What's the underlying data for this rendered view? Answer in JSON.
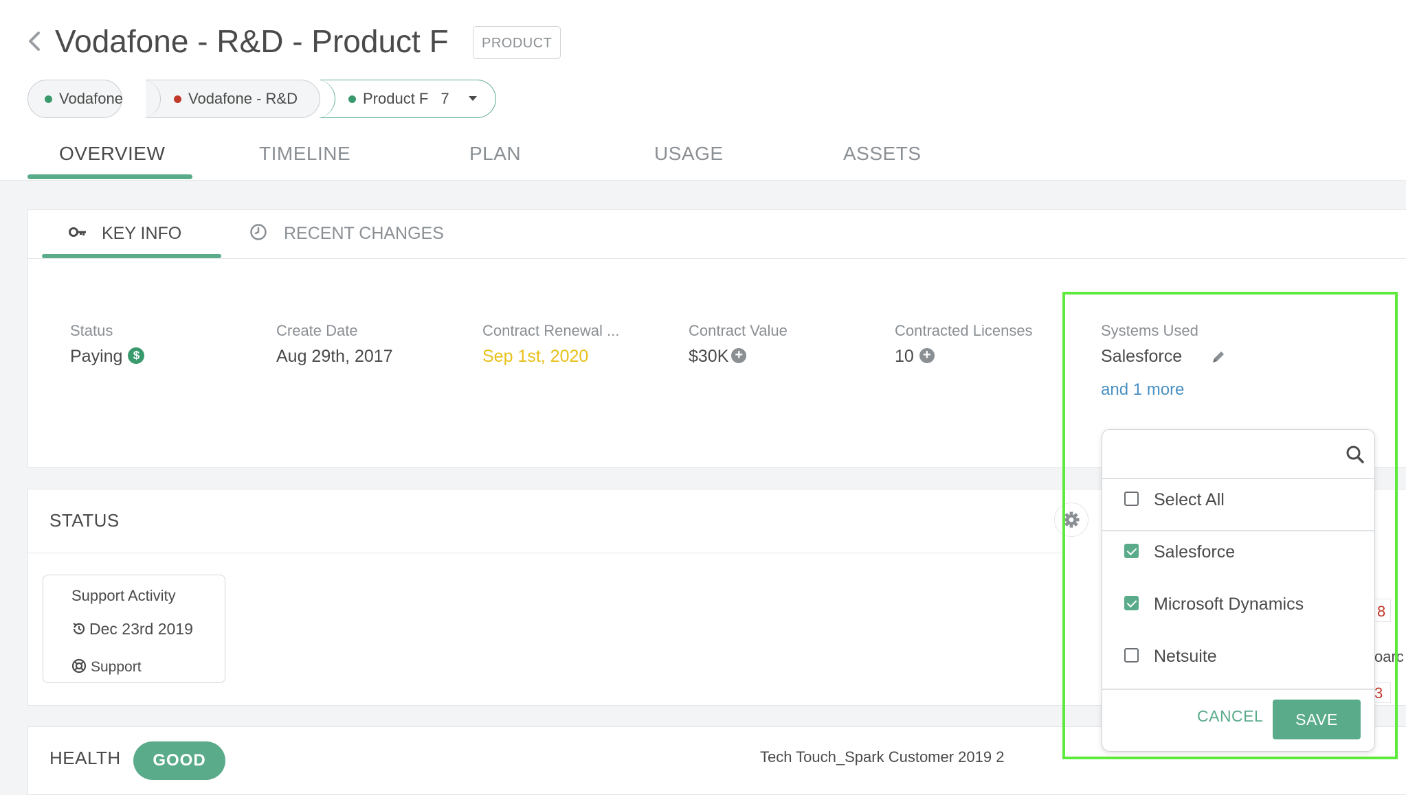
{
  "header": {
    "title": "Vodafone - R&D - Product F",
    "type_badge": "PRODUCT",
    "breadcrumbs": [
      {
        "label": "Vodafone",
        "dot_color": "#3a9a6e"
      },
      {
        "label": "Vodafone - R&D",
        "dot_color": "#c0392b"
      },
      {
        "label": "Product F",
        "count": "7",
        "dot_color": "#3a9a6e"
      }
    ],
    "tabs": [
      {
        "label": "OVERVIEW",
        "active": true
      },
      {
        "label": "TIMELINE",
        "active": false
      },
      {
        "label": "PLAN",
        "active": false
      },
      {
        "label": "USAGE",
        "active": false
      },
      {
        "label": "ASSETS",
        "active": false
      }
    ]
  },
  "key_info": {
    "subtabs": [
      {
        "label": "KEY INFO",
        "icon": "key-icon",
        "active": true
      },
      {
        "label": "RECENT CHANGES",
        "icon": "clock-icon",
        "active": false
      }
    ],
    "fields": [
      {
        "label": "Status",
        "value": "Paying",
        "icon": "dollar-icon"
      },
      {
        "label": "Create Date",
        "value": "Aug 29th, 2017"
      },
      {
        "label": "Contract Renewal ...",
        "value": "Sep 1st, 2020",
        "status_color": "#e8c01a"
      },
      {
        "label": "Contract Value",
        "value": "$30K",
        "icon": "plus-circle-icon"
      },
      {
        "label": "Contracted Licenses",
        "value": "10",
        "icon": "plus-circle-icon"
      },
      {
        "label": "Systems Used",
        "value": "Salesforce",
        "more": "and 1 more",
        "icon": "pencil-icon"
      }
    ]
  },
  "status_section": {
    "title": "STATUS",
    "activity": {
      "title": "Support Activity",
      "date": "Dec 23rd 2019",
      "type": "Support"
    },
    "peek": {
      "num1": "8",
      "text": "oarc",
      "num2": "3"
    }
  },
  "health_section": {
    "title": "HEALTH",
    "badge": "GOOD",
    "program": "Tech Touch_Spark Customer 2019 2"
  },
  "systems_dropdown": {
    "search_placeholder": "",
    "select_all": {
      "label": "Select All",
      "checked": false
    },
    "options": [
      {
        "label": "Salesforce",
        "checked": true
      },
      {
        "label": "Microsoft Dynamics",
        "checked": true
      },
      {
        "label": "Netsuite",
        "checked": false
      }
    ],
    "cancel_label": "CANCEL",
    "save_label": "SAVE"
  },
  "colors": {
    "accent": "#5aab8a",
    "highlight": "#5eea3c",
    "link": "#4a90c2",
    "warning": "#e8c01a",
    "danger": "#c0392b"
  }
}
